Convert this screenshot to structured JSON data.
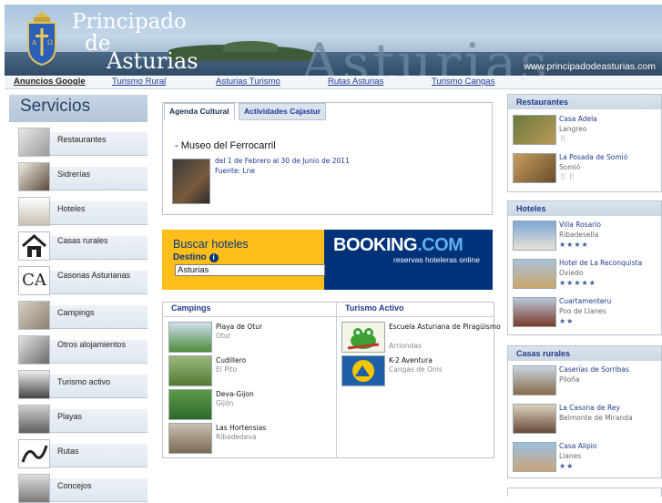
{
  "header": {
    "brand_line1": "Principado",
    "brand_line2": "de",
    "brand_line3": "Asturias",
    "watermark": "Asturias",
    "url": "www.principadodeasturias.com"
  },
  "nav": {
    "ads_label": "Anuncios Google",
    "links": [
      "Turismo Rural",
      "Asturias Turismo",
      "Rutas Asturias",
      "Turismo Cangas"
    ]
  },
  "sidebar": {
    "title": "Servicios",
    "items": [
      {
        "label": "Restaurantes"
      },
      {
        "label": "Sidrerías"
      },
      {
        "label": "Hoteles"
      },
      {
        "label": "Casas rurales"
      },
      {
        "label": "Casonas Asturianas"
      },
      {
        "label": "Campings"
      },
      {
        "label": "Otros alojamientos"
      },
      {
        "label": "Turismo activo"
      },
      {
        "label": "Playas"
      },
      {
        "label": "Rutas"
      },
      {
        "label": "Concejos"
      }
    ]
  },
  "agenda": {
    "tabs": [
      "Agenda Cultural",
      "Actividades Cajastur"
    ],
    "title": "- Museo del Ferrocarril",
    "date": "del 1 de Febrero al 30 de Junio de 2011",
    "source": "Fuente: Lne"
  },
  "booking": {
    "title": "Buscar hoteles",
    "dest_label": "Destino",
    "dest_value": "Asturias",
    "logo_main": "BOOKING",
    "logo_ext": ".COM",
    "subtitle": "reservas hoteleras online"
  },
  "campings": {
    "title": "Campings",
    "items": [
      {
        "name": "Playa de Otur",
        "place": "Otur"
      },
      {
        "name": "Cudillero",
        "place": "El Pito"
      },
      {
        "name": "Deva-Gijon",
        "place": "Gijón"
      },
      {
        "name": "Las Hortensias",
        "place": "Ribadedeva"
      }
    ]
  },
  "turismo_activo": {
    "title": "Turismo Activo",
    "items": [
      {
        "name": "Escuela Asturiana de Piragüismo",
        "place": "Arriondas"
      },
      {
        "name": "K-2 Aventura",
        "place": "Cangas de Onis"
      }
    ]
  },
  "restaurantes": {
    "title": "Restaurantes",
    "items": [
      {
        "name": "Casa Adela",
        "place": "Langreo",
        "extra": "🍴"
      },
      {
        "name": "La Posada de Somió",
        "place": "Somió",
        "extra": "🍴🍴"
      }
    ]
  },
  "hoteles": {
    "title": "Hoteles",
    "items": [
      {
        "name": "Villa Rosario",
        "place": "Ribadesella",
        "stars": "★★★★"
      },
      {
        "name": "Hotel de La Reconquista",
        "place": "Oviedo",
        "stars": "★★★★★"
      },
      {
        "name": "Cuartamenteru",
        "place": "Poo de Llanes",
        "stars": "★★"
      }
    ]
  },
  "casas_rurales": {
    "title": "Casas rurales",
    "items": [
      {
        "name": "Caserías de Sorribas",
        "place": "Piloña",
        "stars": ""
      },
      {
        "name": "La Casona de Rey",
        "place": "Belmonte de Miranda",
        "stars": ""
      },
      {
        "name": "Casa Alipio",
        "place": "Llanes",
        "stars": "★★"
      }
    ]
  }
}
